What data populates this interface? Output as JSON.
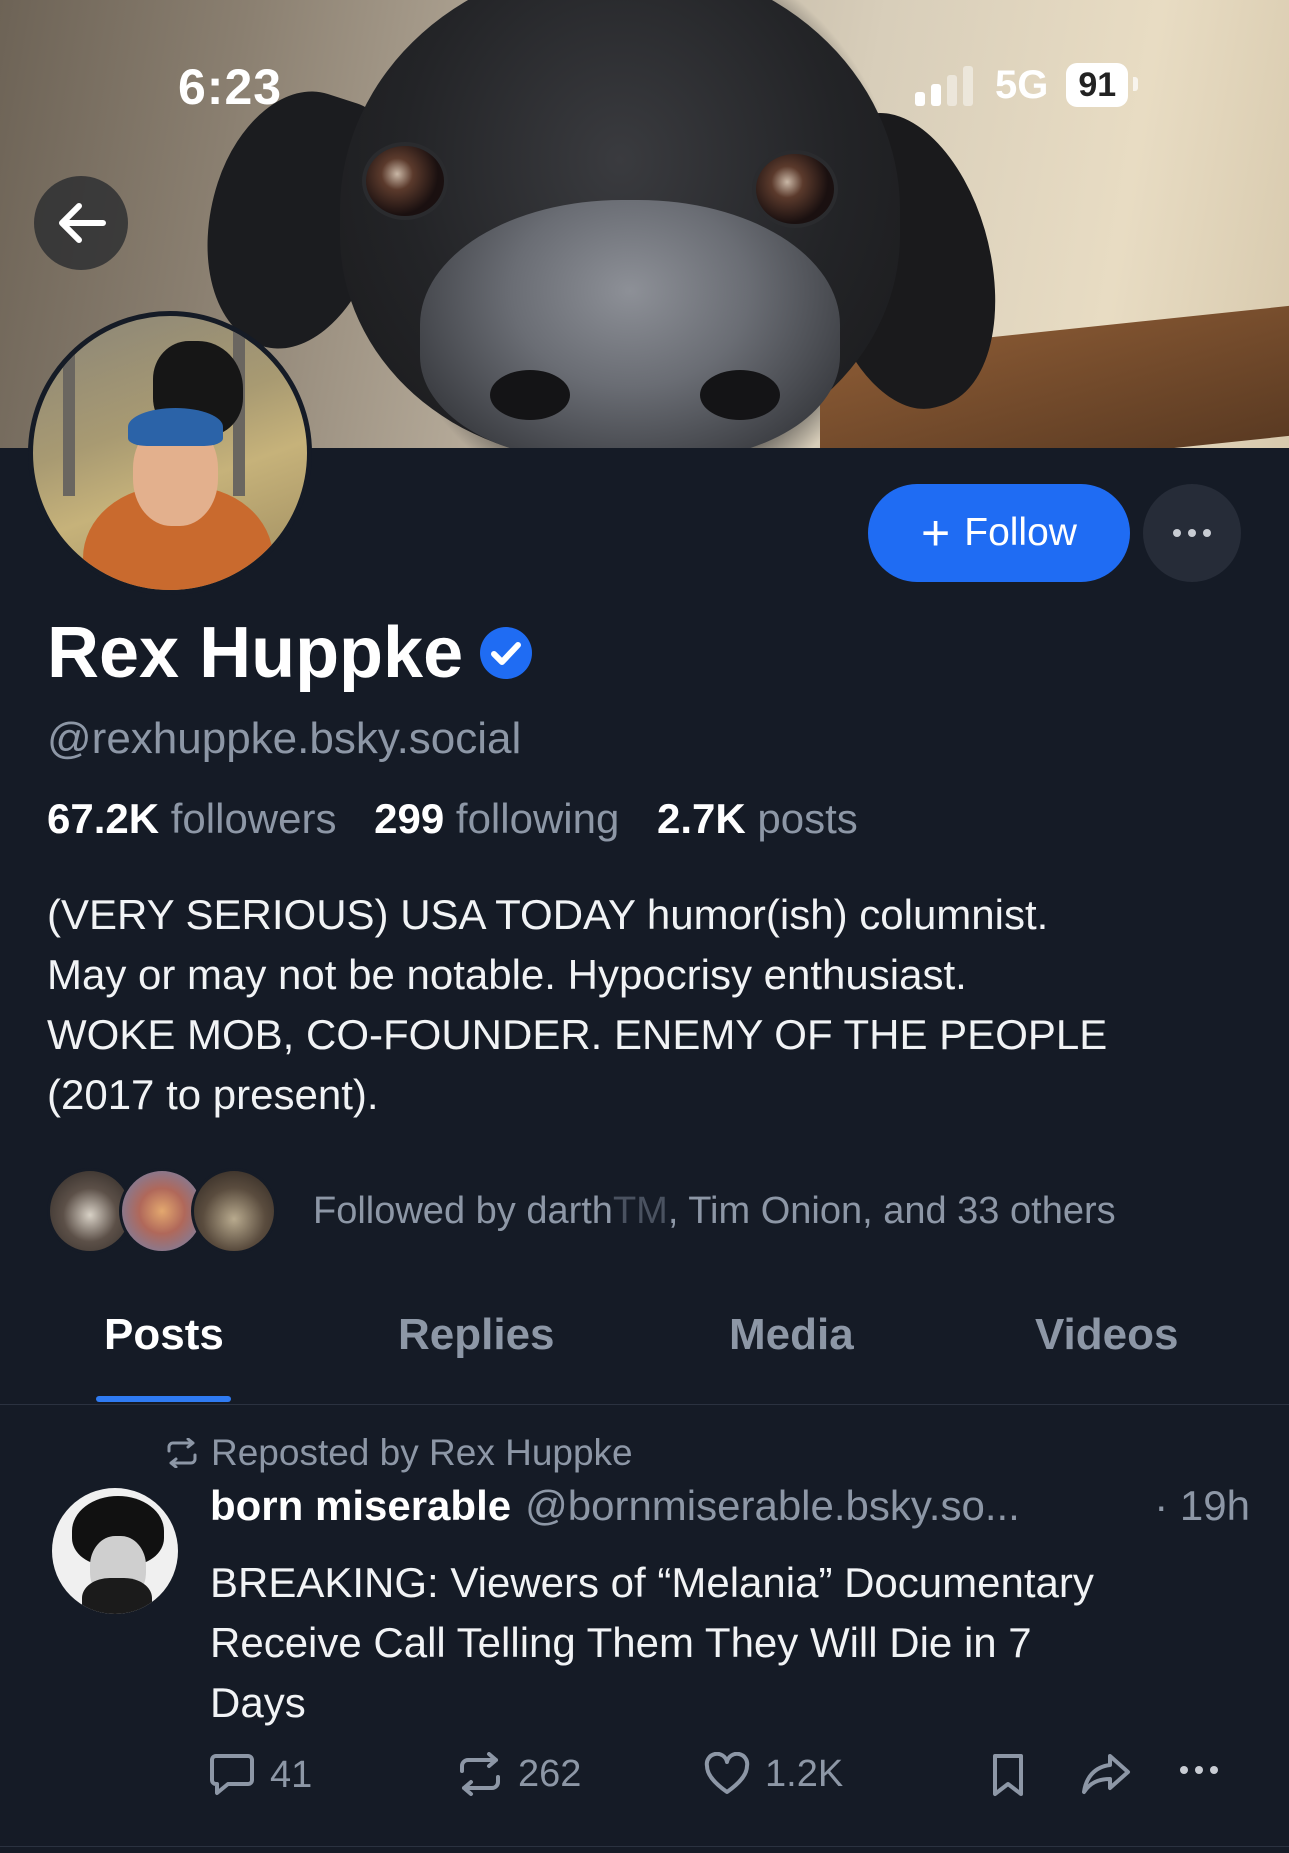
{
  "status_bar": {
    "time": "6:23",
    "network": "5G",
    "battery": "91"
  },
  "profile": {
    "name": "Rex Huppke",
    "handle": "@rexhuppke.bsky.social",
    "stats": {
      "followers_count": "67.2K",
      "followers_label": "followers",
      "following_count": "299",
      "following_label": "following",
      "posts_count": "2.7K",
      "posts_label": "posts"
    },
    "bio_lines": [
      "(VERY SERIOUS) USA TODAY humor(ish) columnist.",
      "May or may not be notable. Hypocrisy enthusiast.",
      "WOKE MOB, CO-FOUNDER. ENEMY OF THE PEOPLE",
      "(2017 to present)."
    ],
    "followed_by": {
      "prefix": "Followed by darth",
      "tm": "TM",
      "rest": ", Tim Onion, and 33 others"
    },
    "follow_label": "Follow"
  },
  "tabs": [
    {
      "label": "Posts",
      "active": true
    },
    {
      "label": "Replies",
      "active": false
    },
    {
      "label": "Media",
      "active": false
    },
    {
      "label": "Videos",
      "active": false
    }
  ],
  "post": {
    "repost_label": "Reposted by Rex Huppke",
    "author": "born miserable",
    "handle": "@bornmiserable.bsky.so...",
    "time": "· 19h",
    "text_lines": [
      "BREAKING: Viewers of “Melania” Documentary",
      "Receive Call Telling Them They Will Die in 7",
      "Days"
    ],
    "replies": "41",
    "reposts": "262",
    "likes": "1.2K"
  },
  "colors": {
    "background": "#151b26",
    "accent": "#1f6cf3",
    "muted_text": "#8d97a6",
    "verified_badge": "#1f6cf3"
  },
  "icons": {
    "back": "arrow-left-icon",
    "verified": "verified-check-icon",
    "more": "ellipsis-icon",
    "repost": "repost-icon",
    "reply": "comment-icon",
    "like": "heart-icon",
    "bookmark": "bookmark-icon",
    "share": "share-icon"
  }
}
